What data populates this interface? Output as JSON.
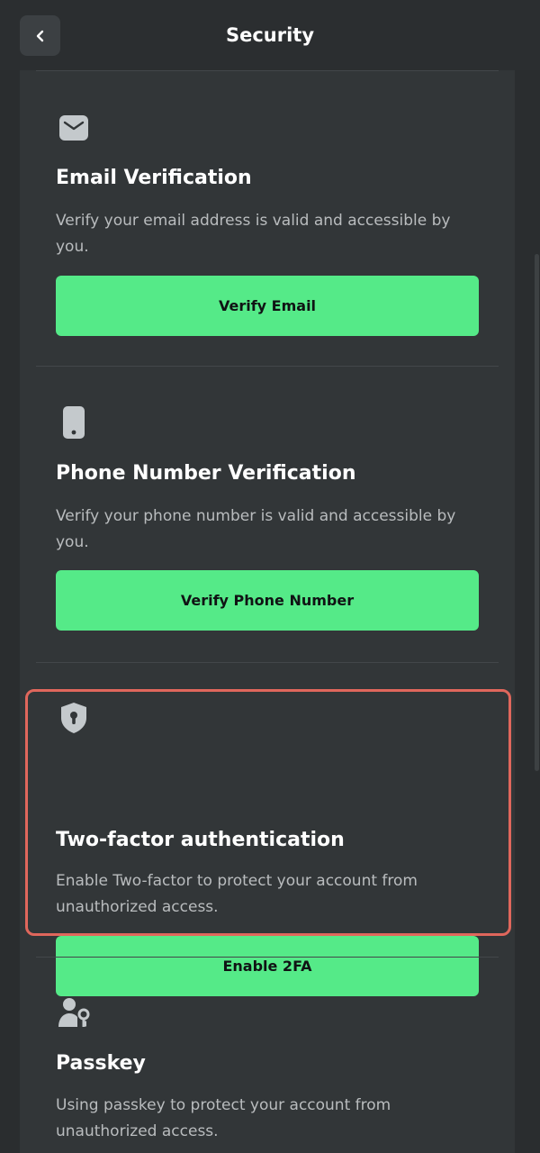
{
  "header": {
    "title": "Security",
    "back_icon": "chevron-left-icon"
  },
  "sections": [
    {
      "icon": "envelope-icon",
      "title": "Email Verification",
      "description": "Verify your email address is valid and accessible by you.",
      "button_label": "Verify Email"
    },
    {
      "icon": "phone-icon",
      "title": "Phone Number Verification",
      "description": "Verify your phone number is valid and accessible by you.",
      "button_label": "Verify Phone Number"
    },
    {
      "icon": "shield-lock-icon",
      "title": "Two-factor authentication",
      "description": "Enable Two-factor to protect your account from unauthorized access.",
      "button_label": "Enable 2FA",
      "highlighted": true
    },
    {
      "icon": "user-key-icon",
      "title": "Passkey",
      "description": "Using passkey to protect your account from unauthorized access."
    }
  ],
  "colors": {
    "accent_button": "#55ea88",
    "highlight_border": "#e0675c",
    "panel_background": "#323638",
    "page_background": "#2a2d2f"
  }
}
